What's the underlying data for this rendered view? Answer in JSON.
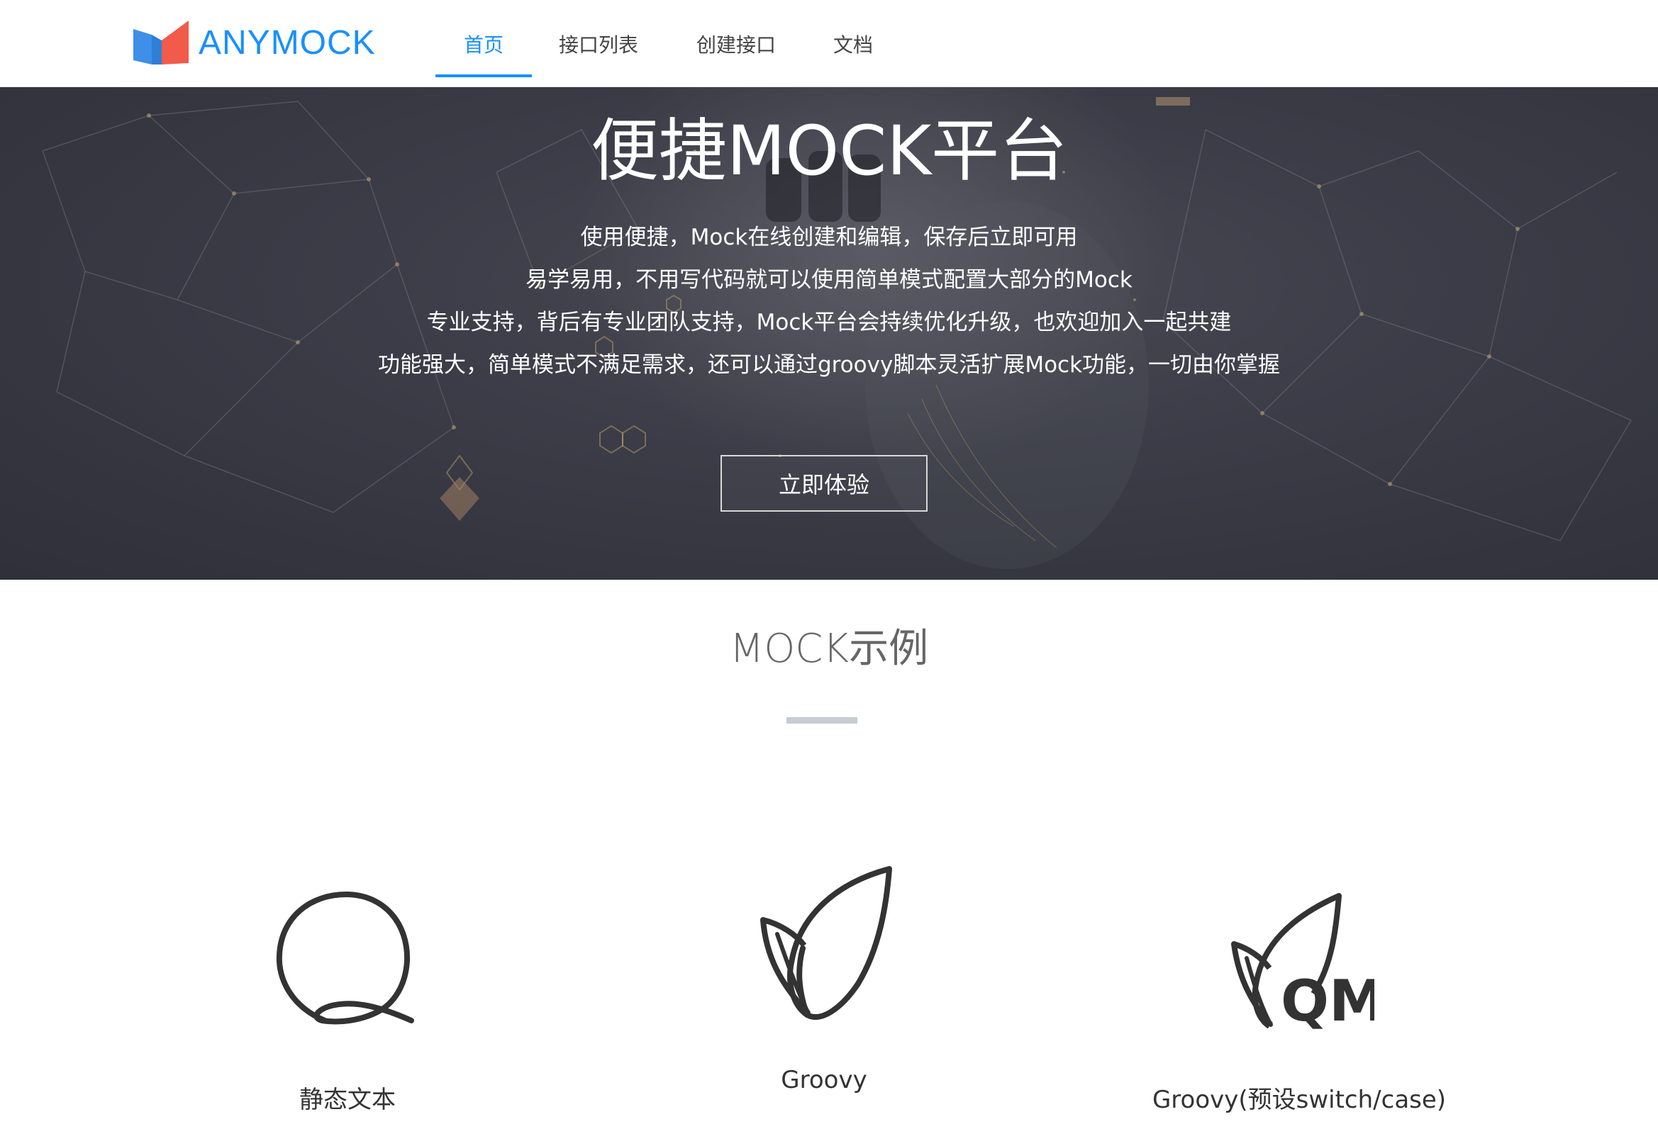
{
  "header": {
    "logo_text": "ANYMOCK",
    "nav": [
      {
        "label": "首页",
        "active": true
      },
      {
        "label": "接口列表",
        "active": false
      },
      {
        "label": "创建接口",
        "active": false
      },
      {
        "label": "文档",
        "active": false
      }
    ]
  },
  "hero": {
    "title": "便捷MOCK平台",
    "lines": [
      "使用便捷，Mock在线创建和编辑，保存后立即可用",
      "易学易用，不用写代码就可以使用简单模式配置大部分的Mock",
      "专业支持，背后有专业团队支持，Mock平台会持续优化升级，也欢迎加入一起共建",
      "功能强大，简单模式不满足需求，还可以通过groovy脚本灵活扩展Mock功能，一切由你掌握"
    ],
    "cta_label": "立即体验"
  },
  "examples": {
    "title": "MOCK示例",
    "cards": [
      {
        "label": "静态文本",
        "icon": "q-loop-icon"
      },
      {
        "label": "Groovy",
        "icon": "leaf-icon"
      },
      {
        "label": "Groovy(预设switch/case)",
        "icon": "leaf-qm-icon"
      }
    ]
  },
  "colors": {
    "accent": "#1890ff",
    "logo_left": "#3d8fe8",
    "logo_right": "#f25a4a",
    "hero_bg": "#3c3d48"
  }
}
